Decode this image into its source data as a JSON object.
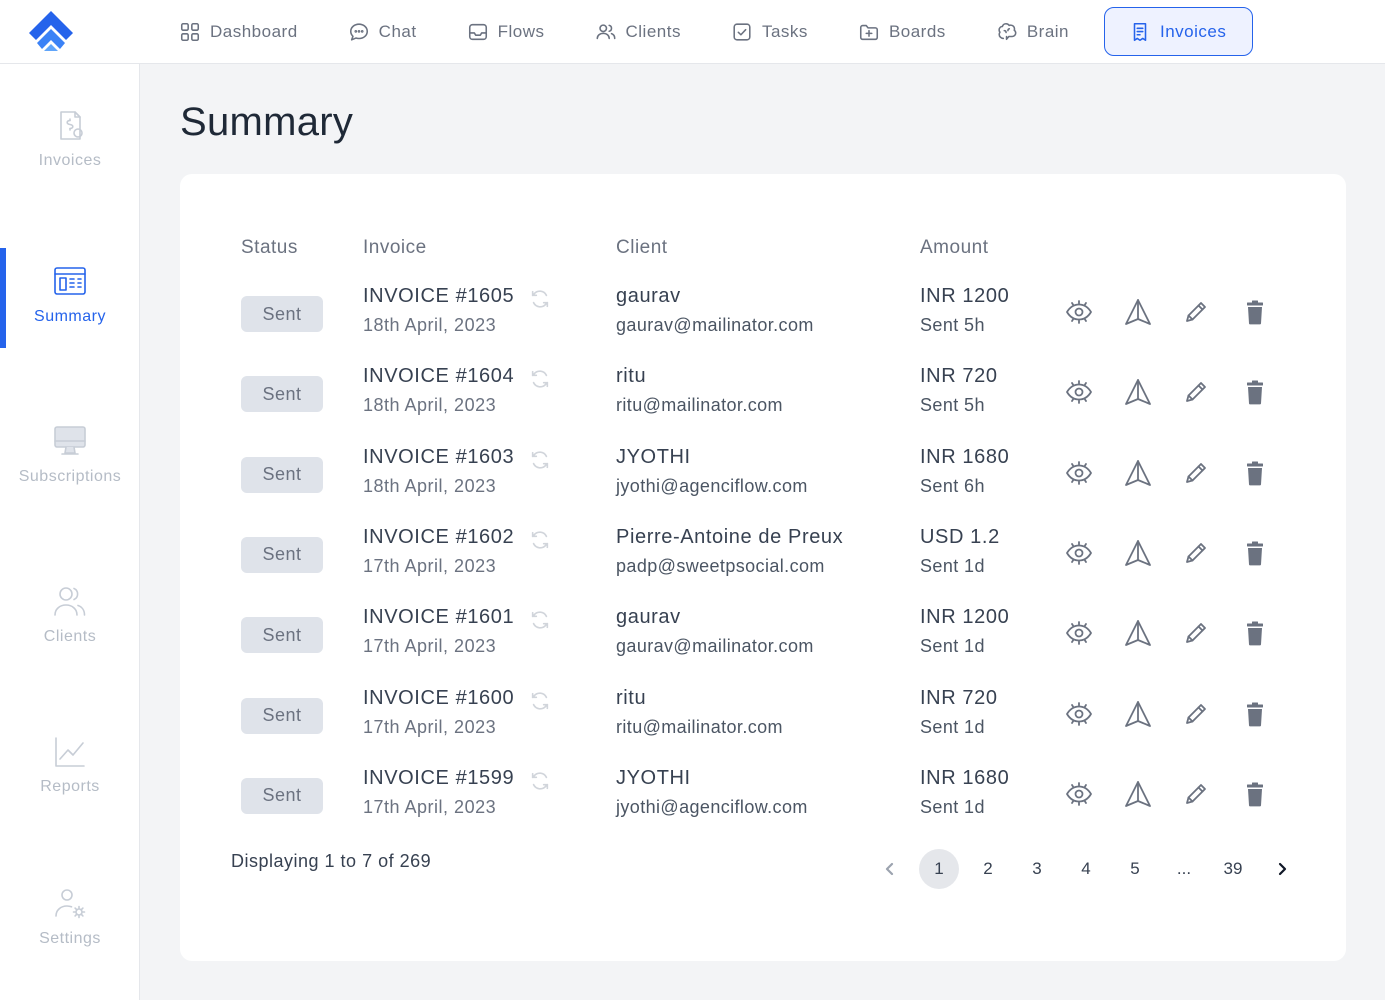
{
  "nav": {
    "items": [
      {
        "label": "Dashboard",
        "icon": "dashboard-icon"
      },
      {
        "label": "Chat",
        "icon": "chat-icon"
      },
      {
        "label": "Flows",
        "icon": "inbox-icon"
      },
      {
        "label": "Clients",
        "icon": "users-icon"
      },
      {
        "label": "Tasks",
        "icon": "checkbox-icon"
      },
      {
        "label": "Boards",
        "icon": "folder-plus-icon"
      },
      {
        "label": "Brain",
        "icon": "brain-icon"
      },
      {
        "label": "Invoices",
        "icon": "receipt-icon",
        "active": true
      }
    ]
  },
  "sidebar": {
    "items": [
      {
        "label": "Invoices",
        "icon": "invoice-file-icon"
      },
      {
        "label": "Summary",
        "icon": "summary-grid-icon",
        "active": true
      },
      {
        "label": "Subscriptions",
        "icon": "monitor-icon"
      },
      {
        "label": "Clients",
        "icon": "users-icon"
      },
      {
        "label": "Reports",
        "icon": "chart-icon"
      },
      {
        "label": "Settings",
        "icon": "user-gear-icon"
      }
    ]
  },
  "page": {
    "title": "Summary"
  },
  "table": {
    "headers": {
      "status": "Status",
      "invoice": "Invoice",
      "client": "Client",
      "amount": "Amount"
    },
    "rows": [
      {
        "status": "Sent",
        "invoice": "INVOICE #1605",
        "date": "18th April, 2023",
        "client": "gaurav",
        "email": "gaurav@mailinator.com",
        "amount": "INR 1200",
        "sent": "Sent 5h"
      },
      {
        "status": "Sent",
        "invoice": "INVOICE #1604",
        "date": "18th April, 2023",
        "client": "ritu",
        "email": "ritu@mailinator.com",
        "amount": "INR 720",
        "sent": "Sent 5h"
      },
      {
        "status": "Sent",
        "invoice": "INVOICE #1603",
        "date": "18th April, 2023",
        "client": "JYOTHI",
        "email": "jyothi@agenciflow.com",
        "amount": "INR 1680",
        "sent": "Sent 6h"
      },
      {
        "status": "Sent",
        "invoice": "INVOICE #1602",
        "date": "17th April, 2023",
        "client": "Pierre-Antoine de Preux",
        "email": "padp@sweetpsocial.com",
        "amount": "USD 1.2",
        "sent": "Sent 1d"
      },
      {
        "status": "Sent",
        "invoice": "INVOICE #1601",
        "date": "17th April, 2023",
        "client": "gaurav",
        "email": "gaurav@mailinator.com",
        "amount": "INR 1200",
        "sent": "Sent 1d"
      },
      {
        "status": "Sent",
        "invoice": "INVOICE #1600",
        "date": "17th April, 2023",
        "client": "ritu",
        "email": "ritu@mailinator.com",
        "amount": "INR 720",
        "sent": "Sent 1d"
      },
      {
        "status": "Sent",
        "invoice": "INVOICE #1599",
        "date": "17th April, 2023",
        "client": "JYOTHI",
        "email": "jyothi@agenciflow.com",
        "amount": "INR 1680",
        "sent": "Sent 1d"
      }
    ]
  },
  "footer": {
    "display_text": "Displaying 1 to 7 of 269",
    "pages": [
      "1",
      "2",
      "3",
      "4",
      "5",
      "...",
      "39"
    ],
    "current_page": "1"
  },
  "colors": {
    "accent": "#2563eb",
    "badge_bg": "#dfe3ea",
    "page_bg": "#f3f4f6"
  }
}
